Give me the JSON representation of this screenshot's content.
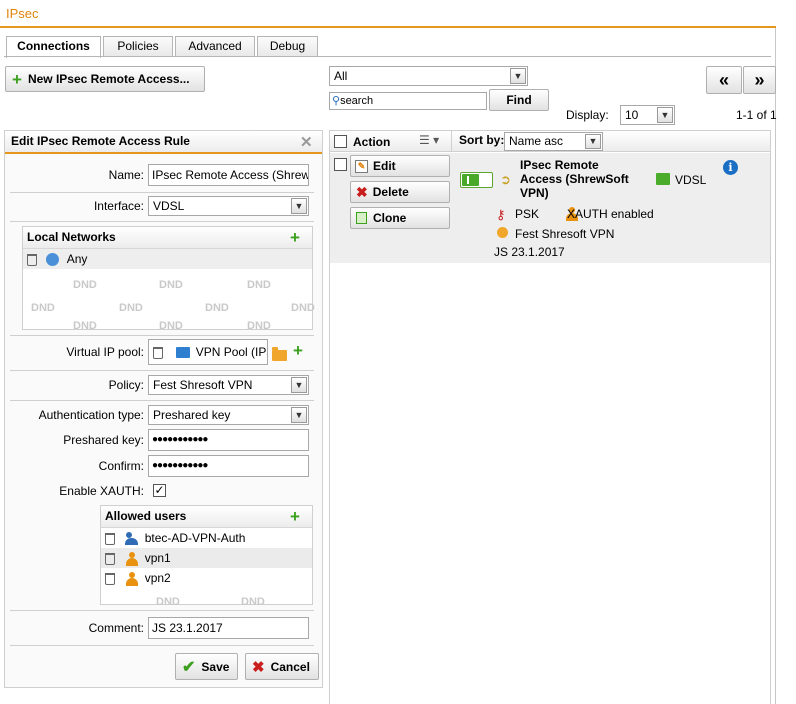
{
  "app": {
    "title": "IPsec"
  },
  "tabs": [
    {
      "label": "Connections"
    },
    {
      "label": "Policies"
    },
    {
      "label": "Advanced"
    },
    {
      "label": "Debug"
    }
  ],
  "toolbar": {
    "new_button": "New IPsec Remote Access...",
    "filter_value": "All",
    "search_placeholder": "search",
    "find_button": "Find",
    "first_button": "«",
    "next_button": "»",
    "display_label": "Display:",
    "display_value": "10",
    "count_text": "1-1 of 1"
  },
  "edit_panel": {
    "title": "Edit IPsec Remote Access Rule",
    "name_label": "Name:",
    "name_value": "IPsec Remote Access (Shrew",
    "interface_label": "Interface:",
    "interface_value": "VDSL",
    "local_networks": {
      "title": "Local Networks",
      "items": [
        {
          "label": "Any"
        }
      ],
      "dnd": "DND"
    },
    "virtual_ip_label": "Virtual IP pool:",
    "virtual_ip_value": "VPN Pool (IPs",
    "policy_label": "Policy:",
    "policy_value": "Fest Shresoft VPN",
    "auth_type_label": "Authentication type:",
    "auth_type_value": "Preshared key",
    "psk_label": "Preshared key:",
    "psk_value": "●●●●●●●●●●●",
    "confirm_label": "Confirm:",
    "confirm_value": "●●●●●●●●●●●",
    "xauth_label": "Enable XAUTH:",
    "xauth_checked": true,
    "allowed_users": {
      "title": "Allowed users",
      "items": [
        {
          "label": "btec-AD-VPN-Auth",
          "icon": "group-icon"
        },
        {
          "label": "vpn1",
          "icon": "user-icon"
        },
        {
          "label": "vpn2",
          "icon": "user-icon"
        }
      ],
      "dnd": "DND"
    },
    "comment_label": "Comment:",
    "comment_value": "JS 23.1.2017",
    "save_button": "Save",
    "cancel_button": "Cancel"
  },
  "list": {
    "action_header": "Action",
    "sortby_label": "Sort by:",
    "sortby_value": "Name asc",
    "row": {
      "edit": "Edit",
      "delete": "Delete",
      "clone": "Clone",
      "name_line1": "IPsec Remote",
      "name_line2": "Access (ShrewSoft",
      "name_line3": "VPN)",
      "interface": "VDSL",
      "psk": "PSK",
      "xauth": "XAUTH enabled",
      "policy": "Fest Shresoft VPN",
      "comment": "JS 23.1.2017"
    }
  },
  "colors": {
    "accent": "#e5961d",
    "green": "#3ca01e",
    "red": "#c81e1e",
    "info": "#1a6fc4"
  }
}
